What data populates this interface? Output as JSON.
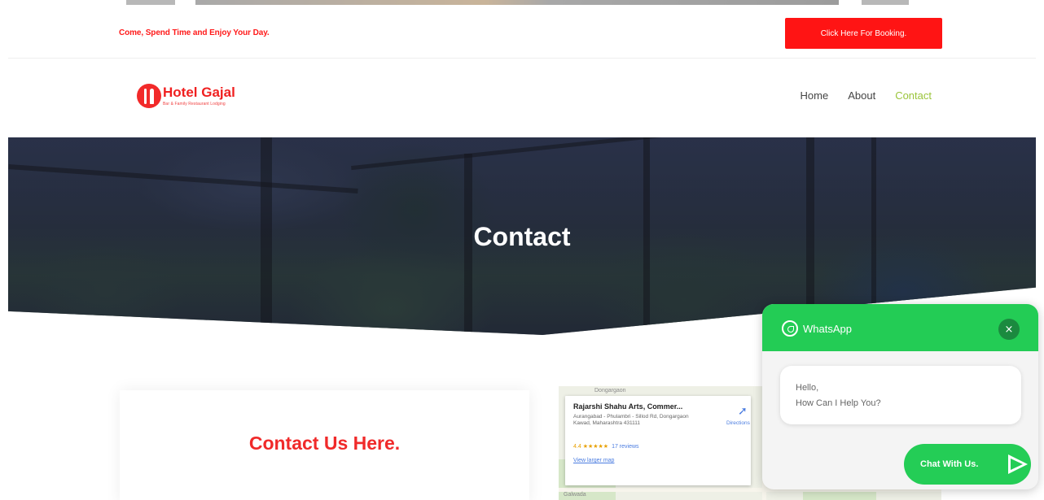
{
  "topbar": {
    "tagline": "Come, Spend Time and Enjoy Your Day.",
    "booking_button": "Click Here For Booking."
  },
  "header": {
    "logo_name": "Hotel Gajal",
    "logo_subtitle": "Bar & Family Restaurant Lodging",
    "nav": [
      {
        "label": "Home",
        "active": false
      },
      {
        "label": "About",
        "active": false
      },
      {
        "label": "Contact",
        "active": true
      }
    ]
  },
  "hero": {
    "title": "Contact"
  },
  "contact_section": {
    "heading": "Contact Us Here."
  },
  "map": {
    "place_name": "Rajarshi Shahu Arts, Commer...",
    "address": "Aurangabad - Phulambri - Sillod Rd, Dongargaon Kawad, Maharashtra 431111",
    "rating": "4.4",
    "stars": "★★★★★",
    "reviews": "17 reviews",
    "directions_label": "Directions",
    "larger_map_link": "View larger map",
    "labels": [
      "Dongargaon",
      "Galwada"
    ]
  },
  "whatsapp": {
    "title": "WhatsApp",
    "close_glyph": "×",
    "message_line1": "Hello,",
    "message_line2": "How Can I Help You?",
    "chat_button": "Chat With Us."
  },
  "colors": {
    "brand_red": "#ff1414",
    "nav_active": "#9ac43a",
    "whatsapp_green": "#24cd56"
  }
}
